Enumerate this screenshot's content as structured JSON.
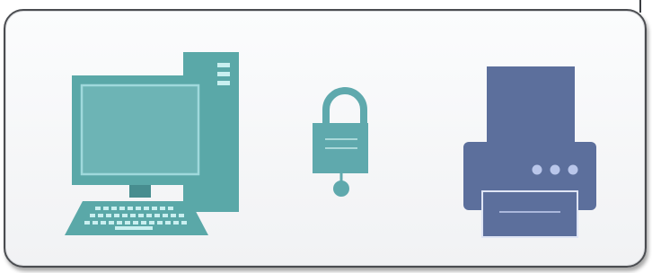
{
  "scene": {
    "items": [
      {
        "icon": "desktop-computer-icon"
      },
      {
        "icon": "padlock-icon"
      },
      {
        "icon": "printer-icon"
      }
    ]
  },
  "colors": {
    "computer": "#5aa8a8",
    "computer_dark": "#478d8f",
    "computer_light": "#9fd9dc",
    "lock": "#5fa9ad",
    "printer": "#5c6f9c",
    "printer_dark": "#4d5f8c",
    "printer_accent": "#b9c6ea",
    "panel_border": "#4a4c50"
  }
}
